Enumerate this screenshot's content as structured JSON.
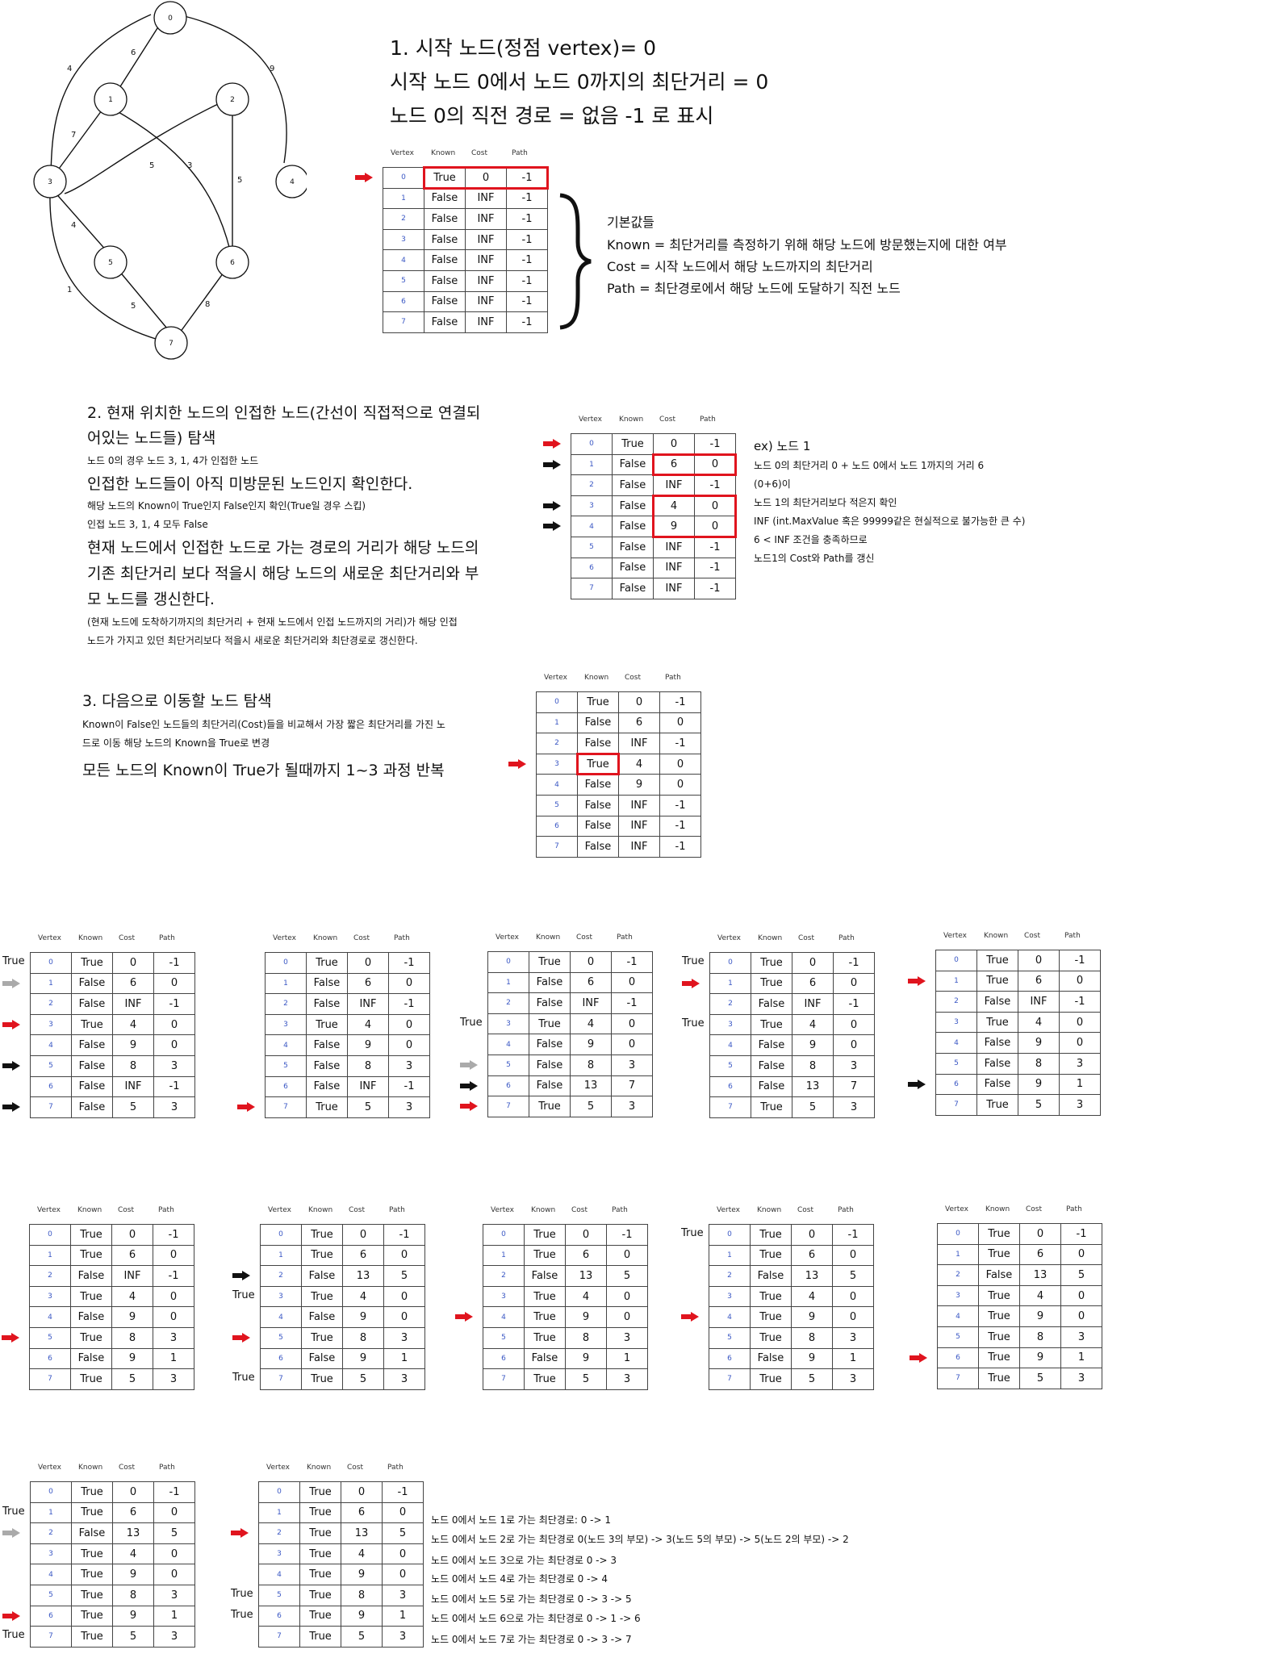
{
  "graph": {
    "nodes": [
      "0",
      "1",
      "2",
      "3",
      "4",
      "5",
      "6",
      "7"
    ],
    "edges": [
      {
        "from": "0",
        "to": "1",
        "weight": "6"
      },
      {
        "from": "0",
        "to": "3",
        "weight": "4"
      },
      {
        "from": "0",
        "to": "4",
        "weight": "9"
      },
      {
        "from": "1",
        "to": "3",
        "weight": "7"
      },
      {
        "from": "1",
        "to": "6",
        "weight": "3"
      },
      {
        "from": "2",
        "to": "3",
        "weight": "5"
      },
      {
        "from": "2",
        "to": "6",
        "weight": "5"
      },
      {
        "from": "3",
        "to": "5",
        "weight": "4"
      },
      {
        "from": "3",
        "to": "7",
        "weight": "1"
      },
      {
        "from": "5",
        "to": "7",
        "weight": "5"
      },
      {
        "from": "6",
        "to": "7",
        "weight": "8"
      }
    ]
  },
  "step1": {
    "lines": [
      "1. 시작 노드(정점 vertex)= 0",
      "시작 노드 0에서 노드 0까지의 최단거리 = 0",
      "노드 0의 직전 경로 = 없음  -1 로 표시"
    ],
    "defaults": [
      "기본값들",
      "Known = 최단거리를 측정하기 위해 해당 노드에 방문했는지에 대한 여부",
      "Cost = 시작 노드에서 해당 노드까지의 최단거리",
      "Path = 최단경로에서 해당 노드에 도달하기 직전 노드"
    ]
  },
  "step2": {
    "lines": [
      "2. 현재 위치한 노드의 인접한 노드(간선이 직접적으로 연결되",
      "어있는 노드들) 탐색",
      "노드 0의 경우 노드 3, 1, 4가 인접한 노드",
      "인접한 노드들이 아직 미방문된 노드인지 확인한다.",
      "해당 노드의 Known이 True인지 False인지 확인(True일 경우 스킵)",
      "인접 노드 3, 1, 4 모두 False",
      "현재 노드에서 인접한 노드로 가는 경로의 거리가  해당 노드의",
      "기존 최단거리 보다 적을시 해당 노드의 새로운 최단거리와 부",
      "모 노드를 갱신한다.",
      "(현재 노드에 도착하기까지의 최단거리 + 현재 노드에서 인접 노드까지의 거리)가 해당 인접",
      "노드가 가지고 있던 최단거리보다 적을시 새로운 최단거리와 최단경로로 갱신한다."
    ],
    "example": [
      "ex) 노드 1",
      "노드 0의 최단거리 0 + 노드 0에서 노드 1까지의 거리 6",
      "(0+6)이",
      "노드 1의 최단거리보다 적은지 확인",
      "INF (int.MaxValue 혹은 99999같은 현실적으로 불가능한 큰 수)",
      "6 < INF 조건을 충족하므로",
      "노드1의 Cost와 Path를 갱신"
    ]
  },
  "step3": {
    "lines": [
      "3. 다음으로 이동할 노드 탐색",
      "Known이 False인 노드들의 최단거리(Cost)들을 비교해서 가장 짧은 최단거리를 가진 노",
      "드로 이동 해당 노드의 Known을 True로 변경",
      "모든 노드의 Known이 True가 될때까지 1~3 과정 반복"
    ]
  },
  "table_headers": [
    "Vertex",
    "Known",
    "Cost",
    "Path"
  ],
  "side_label": "True",
  "tables": [
    {
      "rows": [
        [
          "0",
          "True",
          "0",
          "-1"
        ],
        [
          "1",
          "False",
          "INF",
          "-1"
        ],
        [
          "2",
          "False",
          "INF",
          "-1"
        ],
        [
          "3",
          "False",
          "INF",
          "-1"
        ],
        [
          "4",
          "False",
          "INF",
          "-1"
        ],
        [
          "5",
          "False",
          "INF",
          "-1"
        ],
        [
          "6",
          "False",
          "INF",
          "-1"
        ],
        [
          "7",
          "False",
          "INF",
          "-1"
        ]
      ]
    },
    {
      "rows": [
        [
          "0",
          "True",
          "0",
          "-1"
        ],
        [
          "1",
          "False",
          "6",
          "0"
        ],
        [
          "2",
          "False",
          "INF",
          "-1"
        ],
        [
          "3",
          "False",
          "4",
          "0"
        ],
        [
          "4",
          "False",
          "9",
          "0"
        ],
        [
          "5",
          "False",
          "INF",
          "-1"
        ],
        [
          "6",
          "False",
          "INF",
          "-1"
        ],
        [
          "7",
          "False",
          "INF",
          "-1"
        ]
      ]
    },
    {
      "rows": [
        [
          "0",
          "True",
          "0",
          "-1"
        ],
        [
          "1",
          "False",
          "6",
          "0"
        ],
        [
          "2",
          "False",
          "INF",
          "-1"
        ],
        [
          "3",
          "True",
          "4",
          "0"
        ],
        [
          "4",
          "False",
          "9",
          "0"
        ],
        [
          "5",
          "False",
          "INF",
          "-1"
        ],
        [
          "6",
          "False",
          "INF",
          "-1"
        ],
        [
          "7",
          "False",
          "INF",
          "-1"
        ]
      ]
    },
    {
      "rows": [
        [
          "0",
          "True",
          "0",
          "-1"
        ],
        [
          "1",
          "False",
          "6",
          "0"
        ],
        [
          "2",
          "False",
          "INF",
          "-1"
        ],
        [
          "3",
          "True",
          "4",
          "0"
        ],
        [
          "4",
          "False",
          "9",
          "0"
        ],
        [
          "5",
          "False",
          "8",
          "3"
        ],
        [
          "6",
          "False",
          "INF",
          "-1"
        ],
        [
          "7",
          "False",
          "5",
          "3"
        ]
      ]
    },
    {
      "rows": [
        [
          "0",
          "True",
          "0",
          "-1"
        ],
        [
          "1",
          "False",
          "6",
          "0"
        ],
        [
          "2",
          "False",
          "INF",
          "-1"
        ],
        [
          "3",
          "True",
          "4",
          "0"
        ],
        [
          "4",
          "False",
          "9",
          "0"
        ],
        [
          "5",
          "False",
          "8",
          "3"
        ],
        [
          "6",
          "False",
          "INF",
          "-1"
        ],
        [
          "7",
          "True",
          "5",
          "3"
        ]
      ]
    },
    {
      "rows": [
        [
          "0",
          "True",
          "0",
          "-1"
        ],
        [
          "1",
          "False",
          "6",
          "0"
        ],
        [
          "2",
          "False",
          "INF",
          "-1"
        ],
        [
          "3",
          "True",
          "4",
          "0"
        ],
        [
          "4",
          "False",
          "9",
          "0"
        ],
        [
          "5",
          "False",
          "8",
          "3"
        ],
        [
          "6",
          "False",
          "13",
          "7"
        ],
        [
          "7",
          "True",
          "5",
          "3"
        ]
      ]
    },
    {
      "rows": [
        [
          "0",
          "True",
          "0",
          "-1"
        ],
        [
          "1",
          "True",
          "6",
          "0"
        ],
        [
          "2",
          "False",
          "INF",
          "-1"
        ],
        [
          "3",
          "True",
          "4",
          "0"
        ],
        [
          "4",
          "False",
          "9",
          "0"
        ],
        [
          "5",
          "False",
          "8",
          "3"
        ],
        [
          "6",
          "False",
          "13",
          "7"
        ],
        [
          "7",
          "True",
          "5",
          "3"
        ]
      ]
    },
    {
      "rows": [
        [
          "0",
          "True",
          "0",
          "-1"
        ],
        [
          "1",
          "True",
          "6",
          "0"
        ],
        [
          "2",
          "False",
          "INF",
          "-1"
        ],
        [
          "3",
          "True",
          "4",
          "0"
        ],
        [
          "4",
          "False",
          "9",
          "0"
        ],
        [
          "5",
          "False",
          "8",
          "3"
        ],
        [
          "6",
          "False",
          "9",
          "1"
        ],
        [
          "7",
          "True",
          "5",
          "3"
        ]
      ]
    },
    {
      "rows": [
        [
          "0",
          "True",
          "0",
          "-1"
        ],
        [
          "1",
          "True",
          "6",
          "0"
        ],
        [
          "2",
          "False",
          "INF",
          "-1"
        ],
        [
          "3",
          "True",
          "4",
          "0"
        ],
        [
          "4",
          "False",
          "9",
          "0"
        ],
        [
          "5",
          "True",
          "8",
          "3"
        ],
        [
          "6",
          "False",
          "9",
          "1"
        ],
        [
          "7",
          "True",
          "5",
          "3"
        ]
      ]
    },
    {
      "rows": [
        [
          "0",
          "True",
          "0",
          "-1"
        ],
        [
          "1",
          "True",
          "6",
          "0"
        ],
        [
          "2",
          "False",
          "13",
          "5"
        ],
        [
          "3",
          "True",
          "4",
          "0"
        ],
        [
          "4",
          "False",
          "9",
          "0"
        ],
        [
          "5",
          "True",
          "8",
          "3"
        ],
        [
          "6",
          "False",
          "9",
          "1"
        ],
        [
          "7",
          "True",
          "5",
          "3"
        ]
      ]
    },
    {
      "rows": [
        [
          "0",
          "True",
          "0",
          "-1"
        ],
        [
          "1",
          "True",
          "6",
          "0"
        ],
        [
          "2",
          "False",
          "13",
          "5"
        ],
        [
          "3",
          "True",
          "4",
          "0"
        ],
        [
          "4",
          "True",
          "9",
          "0"
        ],
        [
          "5",
          "True",
          "8",
          "3"
        ],
        [
          "6",
          "False",
          "9",
          "1"
        ],
        [
          "7",
          "True",
          "5",
          "3"
        ]
      ]
    },
    {
      "rows": [
        [
          "0",
          "True",
          "0",
          "-1"
        ],
        [
          "1",
          "True",
          "6",
          "0"
        ],
        [
          "2",
          "False",
          "13",
          "5"
        ],
        [
          "3",
          "True",
          "4",
          "0"
        ],
        [
          "4",
          "True",
          "9",
          "0"
        ],
        [
          "5",
          "True",
          "8",
          "3"
        ],
        [
          "6",
          "False",
          "9",
          "1"
        ],
        [
          "7",
          "True",
          "5",
          "3"
        ]
      ]
    },
    {
      "rows": [
        [
          "0",
          "True",
          "0",
          "-1"
        ],
        [
          "1",
          "True",
          "6",
          "0"
        ],
        [
          "2",
          "False",
          "13",
          "5"
        ],
        [
          "3",
          "True",
          "4",
          "0"
        ],
        [
          "4",
          "True",
          "9",
          "0"
        ],
        [
          "5",
          "True",
          "8",
          "3"
        ],
        [
          "6",
          "True",
          "9",
          "1"
        ],
        [
          "7",
          "True",
          "5",
          "3"
        ]
      ]
    },
    {
      "rows": [
        [
          "0",
          "True",
          "0",
          "-1"
        ],
        [
          "1",
          "True",
          "6",
          "0"
        ],
        [
          "2",
          "False",
          "13",
          "5"
        ],
        [
          "3",
          "True",
          "4",
          "0"
        ],
        [
          "4",
          "True",
          "9",
          "0"
        ],
        [
          "5",
          "True",
          "8",
          "3"
        ],
        [
          "6",
          "True",
          "9",
          "1"
        ],
        [
          "7",
          "True",
          "5",
          "3"
        ]
      ]
    },
    {
      "rows": [
        [
          "0",
          "True",
          "0",
          "-1"
        ],
        [
          "1",
          "True",
          "6",
          "0"
        ],
        [
          "2",
          "True",
          "13",
          "5"
        ],
        [
          "3",
          "True",
          "4",
          "0"
        ],
        [
          "4",
          "True",
          "9",
          "0"
        ],
        [
          "5",
          "True",
          "8",
          "3"
        ],
        [
          "6",
          "True",
          "9",
          "1"
        ],
        [
          "7",
          "True",
          "5",
          "3"
        ]
      ]
    }
  ],
  "results": [
    "노드 0에서 노드 1로 가는 최단경로: 0 -> 1",
    "노드 0에서 노드 2로 가는 최단경로  0(노드 3의 부모) -> 3(노드 5의 부모) -> 5(노드 2의 부모) -> 2",
    "노드 0에서 노드 3으로 가는 최단경로 0 -> 3",
    "노드 0에서 노드 4로 가는 최단경로 0 -> 4",
    "노드 0에서 노드 5로 가는 최단경로 0 -> 3 -> 5",
    "노드 0에서 노드 6으로 가는 최단경로 0 -> 1 -> 6",
    "노드 0에서 노드 7로 가는 최단경로 0 -> 3 -> 7"
  ]
}
